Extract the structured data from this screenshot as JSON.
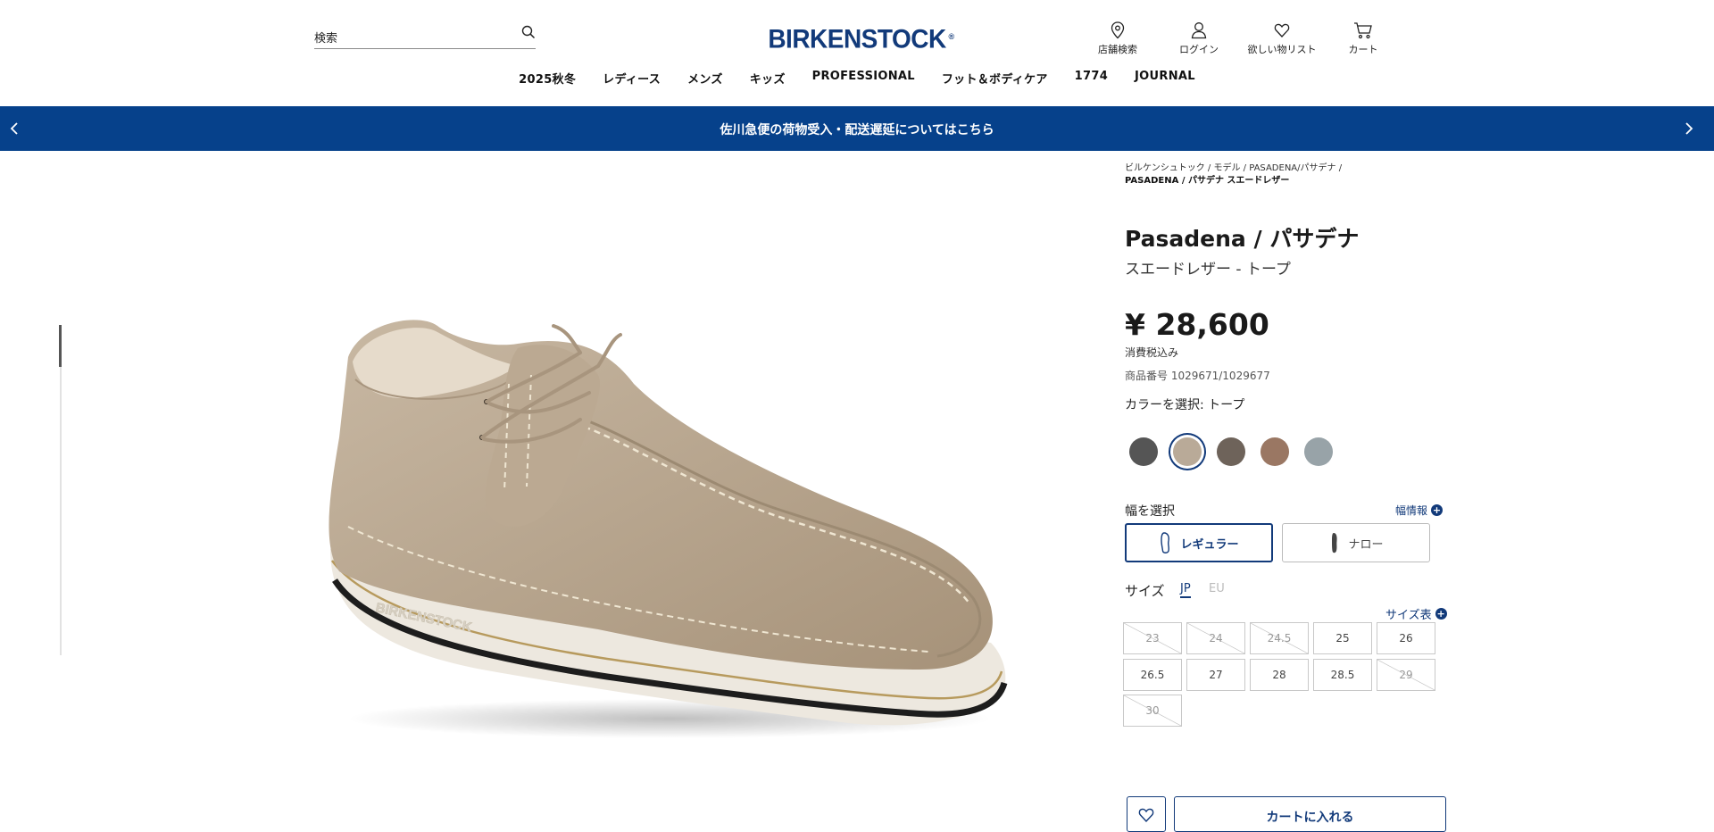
{
  "header": {
    "search_placeholder": "検索",
    "logo": "BIRKENSTOCK",
    "logo_mark": "®",
    "icons": [
      {
        "label": "店舗検索",
        "icon": "store-locator-pin-icon"
      },
      {
        "label": "ログイン",
        "icon": "user-icon"
      },
      {
        "label": "欲しい物リスト",
        "icon": "heart-icon"
      },
      {
        "label": "カート",
        "icon": "cart-icon"
      }
    ],
    "nav": [
      "2025秋冬",
      "レディース",
      "メンズ",
      "キッズ",
      "PROFESSIONAL",
      "フット＆ボディケア",
      "1774",
      "JOURNAL"
    ]
  },
  "banner": {
    "text": "佐川急便の荷物受入・配送遅延についてはこちら",
    "bg_color": "#06418b"
  },
  "breadcrumb": {
    "items": [
      "ビルケンシュトック",
      "モデル",
      "PASADENA/パサデナ"
    ],
    "current": "PASADENA / パサデナ スエードレザー"
  },
  "product": {
    "name": "Pasadena / パサデナ",
    "subtitle": "スエードレザー - トープ",
    "price": "¥ 28,600",
    "tax_note": "消費税込み",
    "sku": "商品番号 1029671/1029677",
    "color_label": "カラーを選択: トープ",
    "swatches": [
      {
        "color": "#555555",
        "selected": false
      },
      {
        "color": "#b9aa98",
        "selected": true
      },
      {
        "color": "#6e635a",
        "selected": false
      },
      {
        "color": "#9a7763",
        "selected": false
      },
      {
        "color": "#98a3a8",
        "selected": false
      }
    ],
    "width_label": "幅を選択",
    "width_info": "幅情報",
    "widths": [
      {
        "label": "レギュラー",
        "selected": true
      },
      {
        "label": "ナロー",
        "selected": false
      }
    ],
    "size_label": "サイズ",
    "size_jp": "JP",
    "size_eu": "EU",
    "size_chart": "サイズ表",
    "sizes": [
      {
        "label": "23",
        "available": false
      },
      {
        "label": "24",
        "available": false
      },
      {
        "label": "24.5",
        "available": false
      },
      {
        "label": "25",
        "available": true
      },
      {
        "label": "26",
        "available": true
      },
      {
        "label": "26.5",
        "available": true
      },
      {
        "label": "27",
        "available": true
      },
      {
        "label": "28",
        "available": true
      },
      {
        "label": "28.5",
        "available": true
      },
      {
        "label": "29",
        "available": false
      },
      {
        "label": "30",
        "available": false
      }
    ],
    "add_to_cart": "カートに入れる",
    "accent_color": "#123a7a"
  }
}
